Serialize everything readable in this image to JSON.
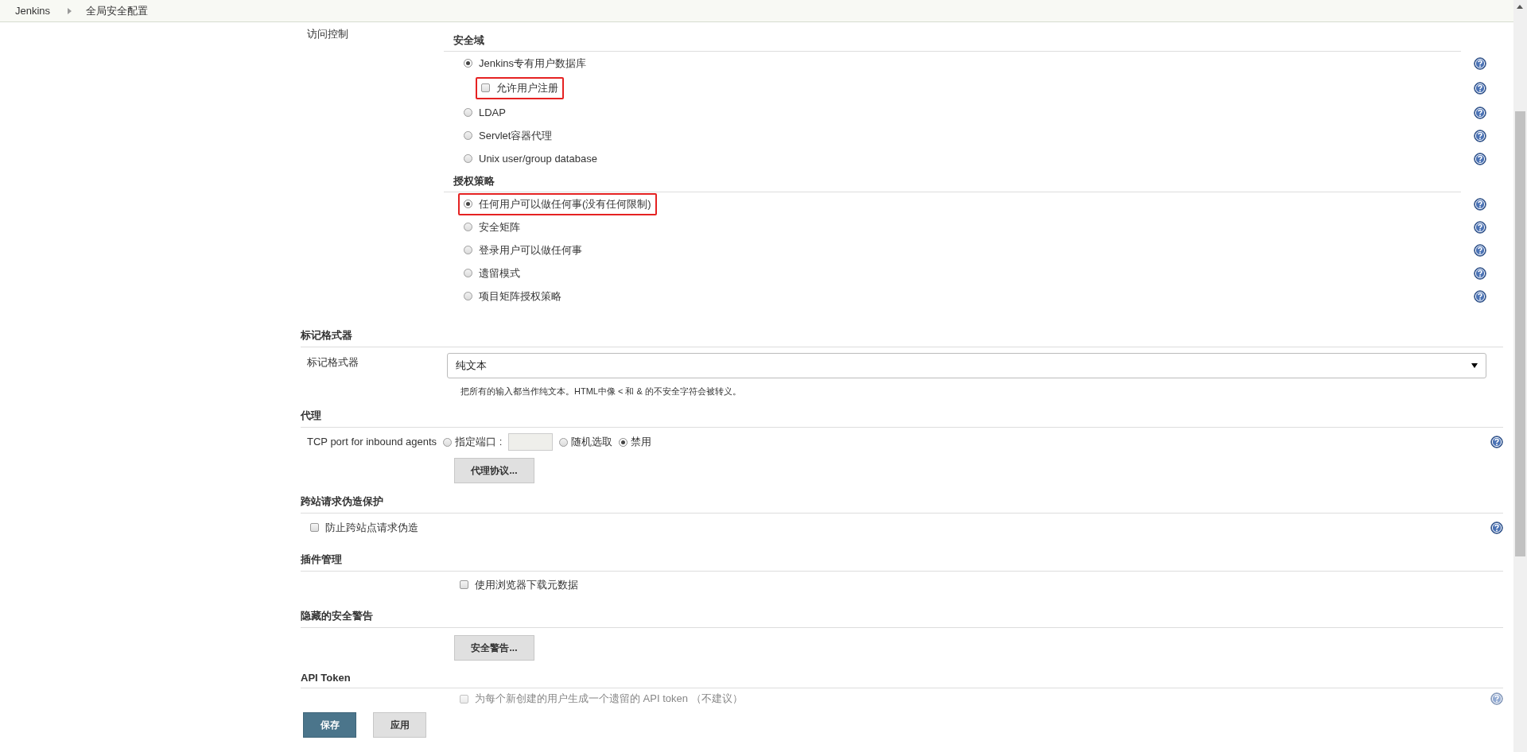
{
  "breadcrumbs": [
    {
      "label": "Jenkins"
    },
    {
      "label": "全局安全配置"
    }
  ],
  "access_control": {
    "label": "访问控制",
    "security_realm": {
      "title": "安全域",
      "options": [
        {
          "label": "Jenkins专有用户数据库",
          "selected": true,
          "highlighted": false,
          "sub_checkbox": {
            "label": "允许用户注册",
            "checked": false,
            "highlighted": true
          }
        },
        {
          "label": "LDAP",
          "selected": false,
          "highlighted": false
        },
        {
          "label": "Servlet容器代理",
          "selected": false,
          "highlighted": false
        },
        {
          "label": "Unix user/group database",
          "selected": false,
          "highlighted": false
        }
      ]
    },
    "authorization": {
      "title": "授权策略",
      "options": [
        {
          "label": "任何用户可以做任何事(没有任何限制)",
          "selected": true,
          "highlighted": true
        },
        {
          "label": "安全矩阵",
          "selected": false,
          "highlighted": false
        },
        {
          "label": "登录用户可以做任何事",
          "selected": false,
          "highlighted": false
        },
        {
          "label": "遗留模式",
          "selected": false,
          "highlighted": false
        },
        {
          "label": "项目矩阵授权策略",
          "selected": false,
          "highlighted": false
        }
      ]
    }
  },
  "markup_formatter": {
    "title": "标记格式器",
    "label": "标记格式器",
    "value": "纯文本",
    "description": "把所有的输入都当作纯文本。HTML中像 < 和 & 的不安全字符会被转义。"
  },
  "agents": {
    "title": "代理",
    "label": "TCP port for inbound agents",
    "options": [
      {
        "label": "指定端口 :",
        "selected": false,
        "kind": "field"
      },
      {
        "label": "随机选取",
        "selected": false,
        "kind": "plain"
      },
      {
        "label": "禁用",
        "selected": true,
        "kind": "plain"
      }
    ],
    "button": "代理协议..."
  },
  "csrf": {
    "title": "跨站请求伪造保护",
    "checkbox": {
      "label": "防止跨站点请求伪造",
      "checked": false
    }
  },
  "plugins": {
    "title": "插件管理",
    "checkbox": {
      "label": "使用浏览器下载元数据",
      "checked": false
    }
  },
  "hidden_warnings": {
    "title": "隐藏的安全警告",
    "button": "安全警告..."
  },
  "api_token": {
    "title": "API Token",
    "obscured": true,
    "checkbox": {
      "label": "为每个新创建的用户生成一个遗留的 API token （不建议）",
      "checked": false
    }
  },
  "actions": [
    {
      "label": "保存",
      "kind": "primary"
    },
    {
      "label": "应用",
      "kind": "secondary"
    }
  ]
}
